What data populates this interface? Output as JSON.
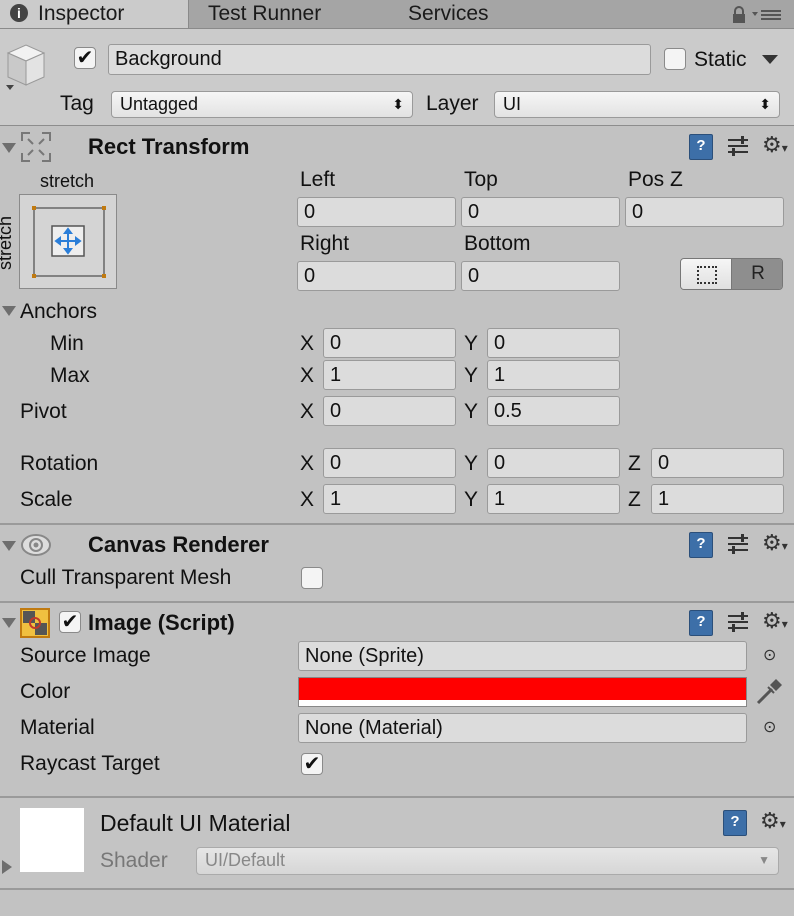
{
  "tabs": [
    {
      "label": "Inspector",
      "active": true
    },
    {
      "label": "Test Runner",
      "active": false
    },
    {
      "label": "Services",
      "active": false
    }
  ],
  "header": {
    "object_name": "Background",
    "active": true,
    "static_label": "Static",
    "tag_label": "Tag",
    "tag_value": "Untagged",
    "layer_label": "Layer",
    "layer_value": "UI"
  },
  "rect_transform": {
    "title": "Rect Transform",
    "anchor_preset_top": "stretch",
    "anchor_preset_side": "stretch",
    "left_label": "Left",
    "left_value": "0",
    "top_label": "Top",
    "top_value": "0",
    "posz_label": "Pos Z",
    "posz_value": "0",
    "right_label": "Right",
    "right_value": "0",
    "bottom_label": "Bottom",
    "bottom_value": "0",
    "raw_button": "R",
    "anchors_label": "Anchors",
    "min_label": "Min",
    "min_x": "0",
    "min_y": "0",
    "max_label": "Max",
    "max_x": "1",
    "max_y": "1",
    "pivot_label": "Pivot",
    "pivot_x": "0",
    "pivot_y": "0.5",
    "rotation_label": "Rotation",
    "rot_x": "0",
    "rot_y": "0",
    "rot_z": "0",
    "scale_label": "Scale",
    "scale_x": "1",
    "scale_y": "1",
    "scale_z": "1",
    "x": "X",
    "y": "Y",
    "z": "Z"
  },
  "canvas_renderer": {
    "title": "Canvas Renderer",
    "cull_label": "Cull Transparent Mesh",
    "cull_checked": false
  },
  "image": {
    "title": "Image (Script)",
    "enabled": true,
    "source_label": "Source Image",
    "source_value": "None (Sprite)",
    "color_label": "Color",
    "color_value": "#ff0000",
    "material_label": "Material",
    "material_value": "None (Material)",
    "raycast_label": "Raycast Target",
    "raycast_checked": true
  },
  "material_preview": {
    "title": "Default UI Material",
    "shader_label": "Shader",
    "shader_value": "UI/Default"
  },
  "colors": {
    "accent": "#3d6fa8",
    "color_swatch": "#ff0000"
  }
}
